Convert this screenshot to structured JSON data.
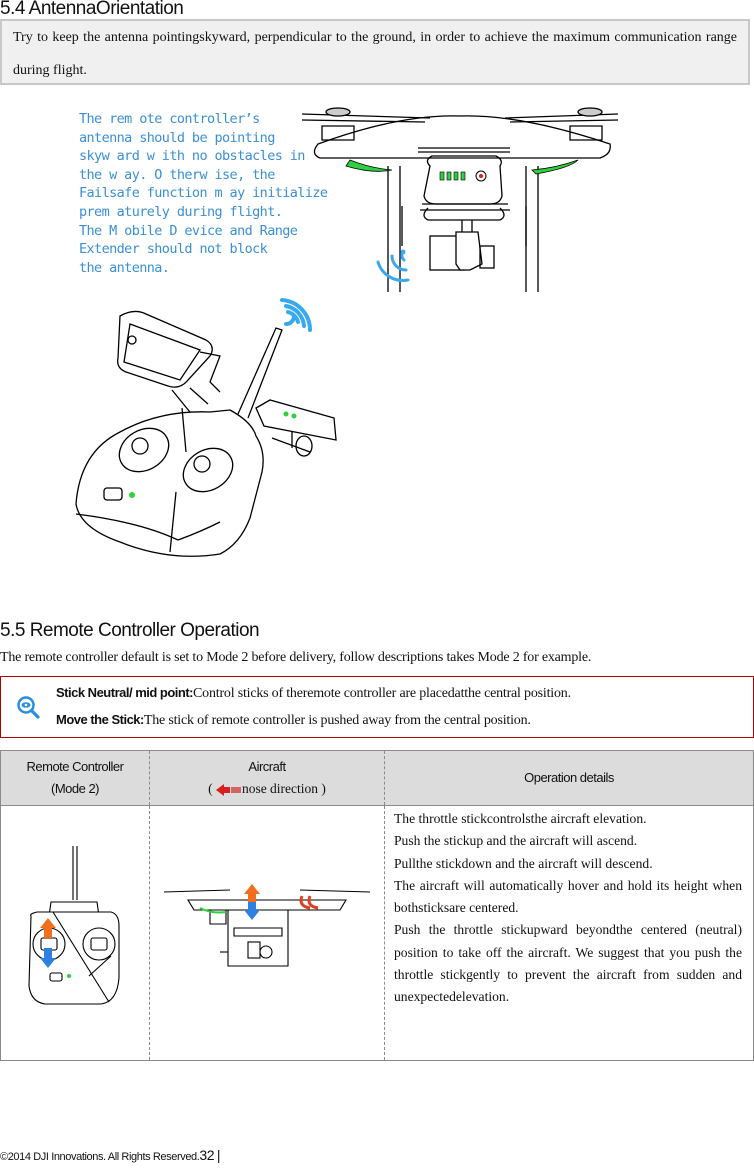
{
  "section_54": {
    "heading": "5.4 AntennaOrientation",
    "note_text": "Try to keep the antenna pointingskyward, perpendicular to the ground, in order to achieve the maximum communication range during flight.",
    "caption_lines": [
      "The rem ote controller’s",
      "antenna should be pointing",
      "skyw ard w ith no obstacles in",
      "the w ay. O therw ise, the",
      "Failsafe function m ay initialize",
      "prem aturely during flight.",
      "The M obile D evice and Range",
      "Extender should not block",
      " the antenna."
    ],
    "accent_color": "#3a8fd6"
  },
  "section_55": {
    "heading": "5.5 Remote Controller Operation",
    "intro": "The remote controller default is set to Mode 2 before delivery, follow descriptions takes Mode 2 for example.",
    "tip_icon": "magnifier-eye-icon",
    "tips": [
      {
        "term": "Stick Neutral/ mid point:",
        "text": "Control sticks of theremote controller are placedatthe central position."
      },
      {
        "term": "Move the Stick:",
        "text": "The stick of remote controller is pushed away from the central position."
      }
    ],
    "table": {
      "headers": {
        "col1_line1": "Remote Controller",
        "col1_line2": "(Mode 2)",
        "col2_line1": "Aircraft",
        "col2_open": "(",
        "col2_nose": "nose direction )",
        "col3": "Operation details"
      },
      "row": {
        "controller_illustration": "remote-controller-mode2-throttle",
        "aircraft_illustration": "aircraft-ascend-descend",
        "details": [
          "The throttle stickcontrolsthe aircraft elevation.",
          "Push the stickup and the aircraft will ascend.",
          "Pullthe stickdown and the aircraft will descend.",
          "The aircraft will automatically hover and hold its height when bothsticksare centered.",
          "Push the throttle stickupward beyondthe centered (neutral) position to take off the aircraft. We suggest that you push the throttle stickgently to prevent the aircraft from sudden and unexpectedelevation."
        ]
      },
      "arrow_colors": {
        "up": "#f07020",
        "down": "#2f80e0",
        "nose": "#d42020"
      }
    }
  },
  "footer": {
    "copyright": "©2014 DJI Innovations. All Rights Reserved.",
    "page_number": "32",
    "separator": "|"
  }
}
